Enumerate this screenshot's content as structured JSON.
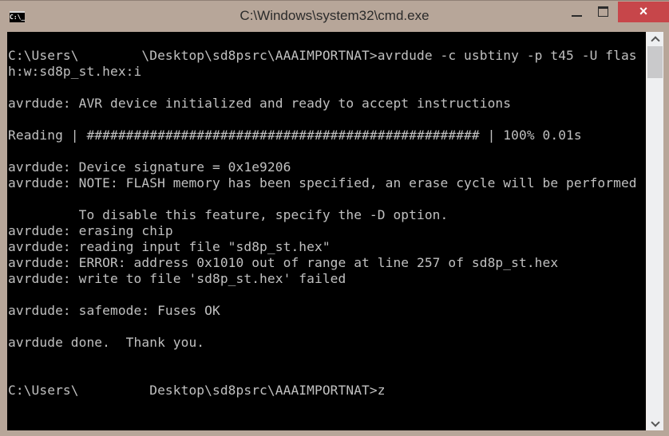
{
  "window": {
    "title": "C:\\Windows\\system32\\cmd.exe",
    "app_icon_text": "C:\\_",
    "buttons": {
      "minimize": "minimize",
      "maximize": "maximize",
      "close": "×"
    }
  },
  "console": {
    "lines": [
      "C:\\Users\\        \\Desktop\\sd8psrc\\AAAIMPORTNAT>avrdude -c usbtiny -p t45 -U flas",
      "h:w:sd8p_st.hex:i",
      "",
      "avrdude: AVR device initialized and ready to accept instructions",
      "",
      "Reading | ################################################## | 100% 0.01s",
      "",
      "avrdude: Device signature = 0x1e9206",
      "avrdude: NOTE: FLASH memory has been specified, an erase cycle will be performed",
      "",
      "         To disable this feature, specify the -D option.",
      "avrdude: erasing chip",
      "avrdude: reading input file \"sd8p_st.hex\"",
      "avrdude: ERROR: address 0x1010 out of range at line 257 of sd8p_st.hex",
      "avrdude: write to file 'sd8p_st.hex' failed",
      "",
      "avrdude: safemode: Fuses OK",
      "",
      "avrdude done.  Thank you.",
      "",
      "",
      "C:\\Users\\         Desktop\\sd8psrc\\AAAIMPORTNAT>z"
    ],
    "read_progress_percent": 100,
    "read_time": "0.01s",
    "current_input": "z"
  },
  "colors": {
    "frame": "#b7a699",
    "console_bg": "#000000",
    "console_fg": "#c0c0c0",
    "close_button": "#c7464a"
  }
}
